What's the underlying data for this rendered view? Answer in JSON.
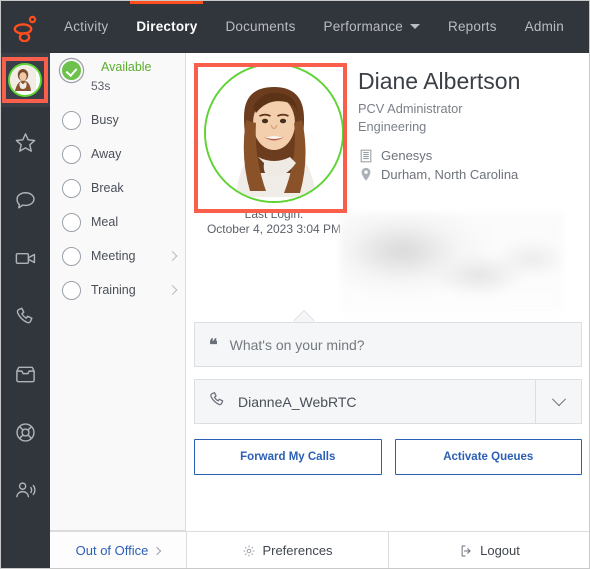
{
  "topnav": {
    "logo_icon": "genesys-logo-icon",
    "accent_color": "#ff4f1f",
    "background": "#31353c",
    "items": [
      {
        "label": "Activity",
        "active": false,
        "has_caret": false
      },
      {
        "label": "Directory",
        "active": true,
        "has_caret": false
      },
      {
        "label": "Documents",
        "active": false,
        "has_caret": false
      },
      {
        "label": "Performance",
        "active": false,
        "has_caret": true
      },
      {
        "label": "Reports",
        "active": false,
        "has_caret": false
      },
      {
        "label": "Admin",
        "active": false,
        "has_caret": false
      }
    ]
  },
  "rail": {
    "avatar_name": "user-avatar",
    "icons": [
      "star-icon",
      "chat-bubble-icon",
      "video-camera-icon",
      "phone-icon",
      "inbox-tray-icon",
      "lifebuoy-icon",
      "person-speaking-icon"
    ]
  },
  "annotations": {
    "highlight_color": "#fa5f4b",
    "boxes": [
      "rail-avatar-highlight",
      "profile-avatar-highlight"
    ]
  },
  "status_panel": {
    "items": [
      {
        "label": "Available",
        "sub": "53s",
        "selected": true,
        "chevron": false
      },
      {
        "label": "Busy",
        "sub": "",
        "selected": false,
        "chevron": false
      },
      {
        "label": "Away",
        "sub": "",
        "selected": false,
        "chevron": false
      },
      {
        "label": "Break",
        "sub": "",
        "selected": false,
        "chevron": false
      },
      {
        "label": "Meal",
        "sub": "",
        "selected": false,
        "chevron": false
      },
      {
        "label": "Meeting",
        "sub": "",
        "selected": false,
        "chevron": true
      },
      {
        "label": "Training",
        "sub": "",
        "selected": false,
        "chevron": true
      }
    ],
    "available_color": "#5aad2e"
  },
  "profile": {
    "avatar_name": "profile-avatar",
    "presence_ring_color": "#5fd334",
    "last_login_label": "Last Login:",
    "last_login_value": "October 4, 2023 3:04 PM",
    "name": "Diane Albertson",
    "title": "PCV Administrator",
    "department": "Engineering",
    "organization": "Genesys",
    "organization_icon": "building-icon",
    "location": "Durham, North Carolina",
    "location_icon": "map-pin-icon",
    "redacted_region": "blurred-details-block"
  },
  "widgets": {
    "status_bubble": {
      "icon": "quote-icon",
      "placeholder": "What's on your mind?"
    },
    "station_select": {
      "icon": "phone-handset-icon",
      "value": "DianneA_WebRTC",
      "chevron_icon": "chevron-down-icon"
    },
    "buttons": [
      {
        "label": "Forward My Calls"
      },
      {
        "label": "Activate Queues"
      }
    ],
    "button_color": "#2b5fb5"
  },
  "footer": {
    "out_of_office": "Out of Office",
    "out_of_office_chevron": "chevron-right-icon",
    "preferences": "Preferences",
    "preferences_icon": "gear-icon",
    "logout": "Logout",
    "logout_icon": "logout-arrow-icon"
  }
}
